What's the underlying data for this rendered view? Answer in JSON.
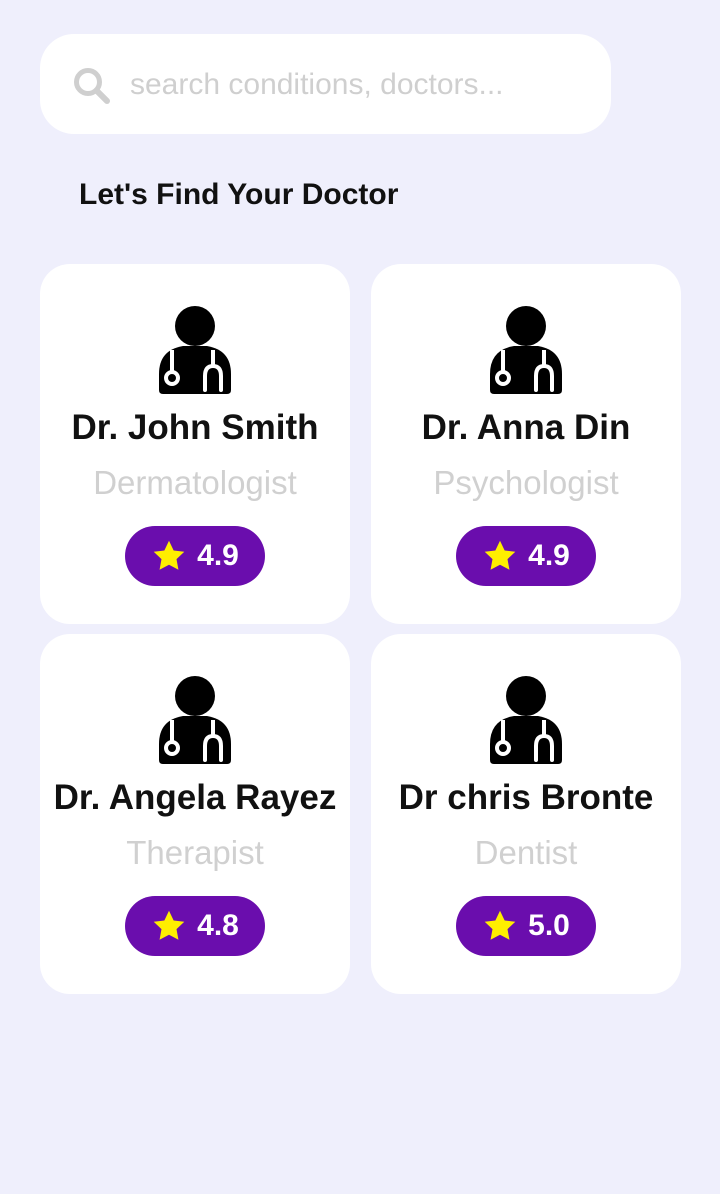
{
  "search": {
    "placeholder": "search conditions, doctors...",
    "value": "",
    "icon": "search-icon"
  },
  "page": {
    "title": "Let's Find Your Doctor"
  },
  "colors": {
    "background": "#efeffc",
    "card": "#ffffff",
    "accent": "#6a0dad",
    "star": "#ffee00",
    "muted_text": "#d0d0d0"
  },
  "doctors": [
    {
      "name": "Dr. John Smith",
      "specialty": "Dermatologist",
      "rating": "4.9",
      "icon": "doctor-icon"
    },
    {
      "name": "Dr. Anna Din",
      "specialty": "Psychologist",
      "rating": "4.9",
      "icon": "doctor-icon"
    },
    {
      "name": "Dr. Angela Rayez",
      "specialty": "Therapist",
      "rating": "4.8",
      "icon": "doctor-icon"
    },
    {
      "name": "Dr chris Bronte",
      "specialty": "Dentist",
      "rating": "5.0",
      "icon": "doctor-icon"
    }
  ]
}
